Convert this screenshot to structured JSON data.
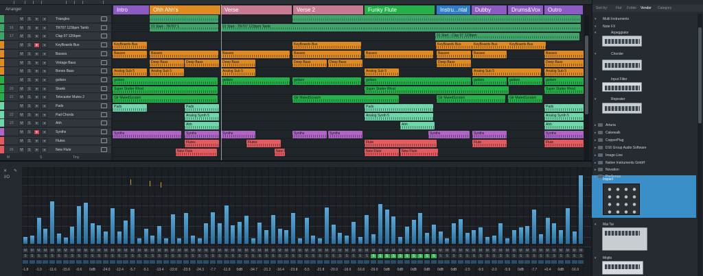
{
  "arranger": {
    "label": "Arranger",
    "sections": [
      {
        "name": "Intro",
        "color": "#8e5bc4"
      },
      {
        "name": "Ohh Ahh's",
        "color": "#e08a22"
      },
      {
        "name": "Verse",
        "color": "#c77b93"
      },
      {
        "name": "Verse 2",
        "color": "#c77b93"
      },
      {
        "name": "Funky Flute",
        "color": "#25b04a"
      },
      {
        "name": "Instru...ntal",
        "color": "#2f7ec9"
      },
      {
        "name": "Dubby",
        "color": "#8e5bc4"
      },
      {
        "name": "Drums&Vox",
        "color": "#8e5bc4"
      },
      {
        "name": "Outro",
        "color": "#8e5bc4"
      }
    ]
  },
  "tracks": [
    {
      "num": "",
      "name": "Triangles",
      "color": "#3fa36a",
      "rec": false
    },
    {
      "num": "16",
      "name": "TR707 123bpm Tamb",
      "color": "#3fa36a",
      "rec": false
    },
    {
      "num": "17",
      "name": "Clap 07 120bpm",
      "color": "#3fa36a",
      "rec": false
    },
    {
      "num": "",
      "name": "KeyBoards Bus",
      "color": "#e08a22",
      "rec": true
    },
    {
      "num": "",
      "name": "Basses",
      "color": "#e08a22",
      "rec": false
    },
    {
      "num": "",
      "name": "Vintage Bass",
      "color": "#e08a22",
      "rec": false
    },
    {
      "num": "",
      "name": "Bones Bass",
      "color": "#e08a22",
      "rec": false
    },
    {
      "num": "",
      "name": "guitars",
      "color": "#25b04a",
      "rec": false
    },
    {
      "num": "20",
      "name": "Skank",
      "color": "#25b04a",
      "rec": false
    },
    {
      "num": "21",
      "name": "Telecaster Mutes 2",
      "color": "#25b04a",
      "rec": false
    },
    {
      "num": "",
      "name": "Pads",
      "color": "#6fd6a9",
      "rec": false
    },
    {
      "num": "22",
      "name": "Pad Chords",
      "color": "#6fd6a9",
      "rec": false
    },
    {
      "num": "23",
      "name": "Ahh",
      "color": "#6fd6a9",
      "rec": false
    },
    {
      "num": "",
      "name": "Synths",
      "color": "#b065c6",
      "rec": true
    },
    {
      "num": "",
      "name": "Flutes",
      "color": "#e45a5f",
      "rec": false
    },
    {
      "num": "26",
      "name": "New Flute",
      "color": "#e45a5f",
      "rec": false
    }
  ],
  "track_buttons": {
    "mute": "M",
    "solo": "S"
  },
  "tracklist_footer": {
    "mute": "M",
    "solo": "S",
    "tiny": "Tiny"
  },
  "clip_labels": {
    "tr707": "01 Start - TR707 1",
    "tr707b": "01 Start - TR707 123bpm Tamb",
    "clap": "01 Start - Clap 07 123bpm",
    "kbus": "KeyBoards Bus",
    "basses": "Basses",
    "deep": "Deep Bass",
    "asub": "Analog Sub 5",
    "guitars": "guitars",
    "stutter": "Super Stutter Rhod",
    "gtr": "Gtr MutedScratch",
    "pads": "Pads",
    "asyn": "Analog Synth 5",
    "ahh": "Ahh",
    "synths": "Synths",
    "flutes": "Flutes",
    "flute": "Flute",
    "newflute": "New Flute"
  },
  "browser": {
    "tabs": {
      "sortby": "Sort by:",
      "flat": "Flat",
      "folder": "Folder",
      "vendor": "Vendor",
      "category": "Category"
    },
    "items": [
      {
        "label": "Multi Instruments",
        "level": 1
      },
      {
        "label": "Note FX",
        "level": 1
      },
      {
        "label": "Arpeggiator",
        "level": 2
      },
      {
        "label": "Chorder",
        "level": 2
      },
      {
        "label": "Input Filter",
        "level": 2
      },
      {
        "label": "Repeater",
        "level": 2
      },
      {
        "label": "Arturia",
        "level": 0
      },
      {
        "label": "Cakewalk",
        "level": 0
      },
      {
        "label": "CopperPlug",
        "level": 0
      },
      {
        "label": "D16 Group Audio Software",
        "level": 0
      },
      {
        "label": "Image-Line",
        "level": 0
      },
      {
        "label": "Native Instruments GmbH",
        "level": 0
      },
      {
        "label": "Novation",
        "level": 0
      },
      {
        "label": "PreSonus",
        "level": 0
      },
      {
        "label": "Impact",
        "level": 1
      },
      {
        "label": "Mai Tai",
        "level": 1
      },
      {
        "label": "Mojito",
        "level": 1
      }
    ]
  },
  "mixer": {
    "io_label": "I/O",
    "volumes": [
      "-1.8",
      "-1.0",
      "-11.6",
      "-15.6",
      "-0.6",
      "0dB",
      "-24.0",
      "-12.4",
      "-5.7",
      "-5.1",
      "-13.4",
      "-22.8",
      "-23.5",
      "-24.3",
      "-7.7",
      "-11.9",
      "0dB",
      "-34.7",
      "-21.2",
      "-16.4",
      "-23.8",
      "-5.5",
      "-21.8",
      "-20.9",
      "-16.6",
      "-16.8",
      "-29.0",
      "0dB",
      "0dB",
      "0dB",
      "0dB",
      "0dB",
      "0dB",
      "-2.5",
      "-9.5",
      "-2.0",
      "-5.9",
      "0dB",
      "-7.7",
      "+0.4",
      "0dB",
      "-16.9",
      "-0.7",
      "-1.0",
      "0dB"
    ],
    "levels": [
      10,
      12,
      38,
      22,
      62,
      15,
      9,
      25,
      55,
      60,
      30,
      27,
      18,
      52,
      18,
      34,
      51,
      8,
      22,
      12,
      26,
      8,
      43,
      8,
      45,
      12,
      8,
      30,
      46,
      30,
      56,
      27,
      32,
      41,
      8,
      31,
      20,
      42,
      22,
      20,
      45,
      8,
      38,
      12,
      8,
      53,
      28,
      16,
      12,
      32,
      10,
      42,
      14,
      58,
      50,
      40,
      10,
      25,
      35,
      45,
      16,
      28,
      18,
      8,
      30,
      36,
      16,
      20,
      24,
      10,
      12,
      30,
      8,
      20,
      24,
      26,
      50,
      14,
      38,
      30,
      20,
      52,
      18,
      100
    ],
    "solo_on_range": [
      52,
      62
    ]
  }
}
